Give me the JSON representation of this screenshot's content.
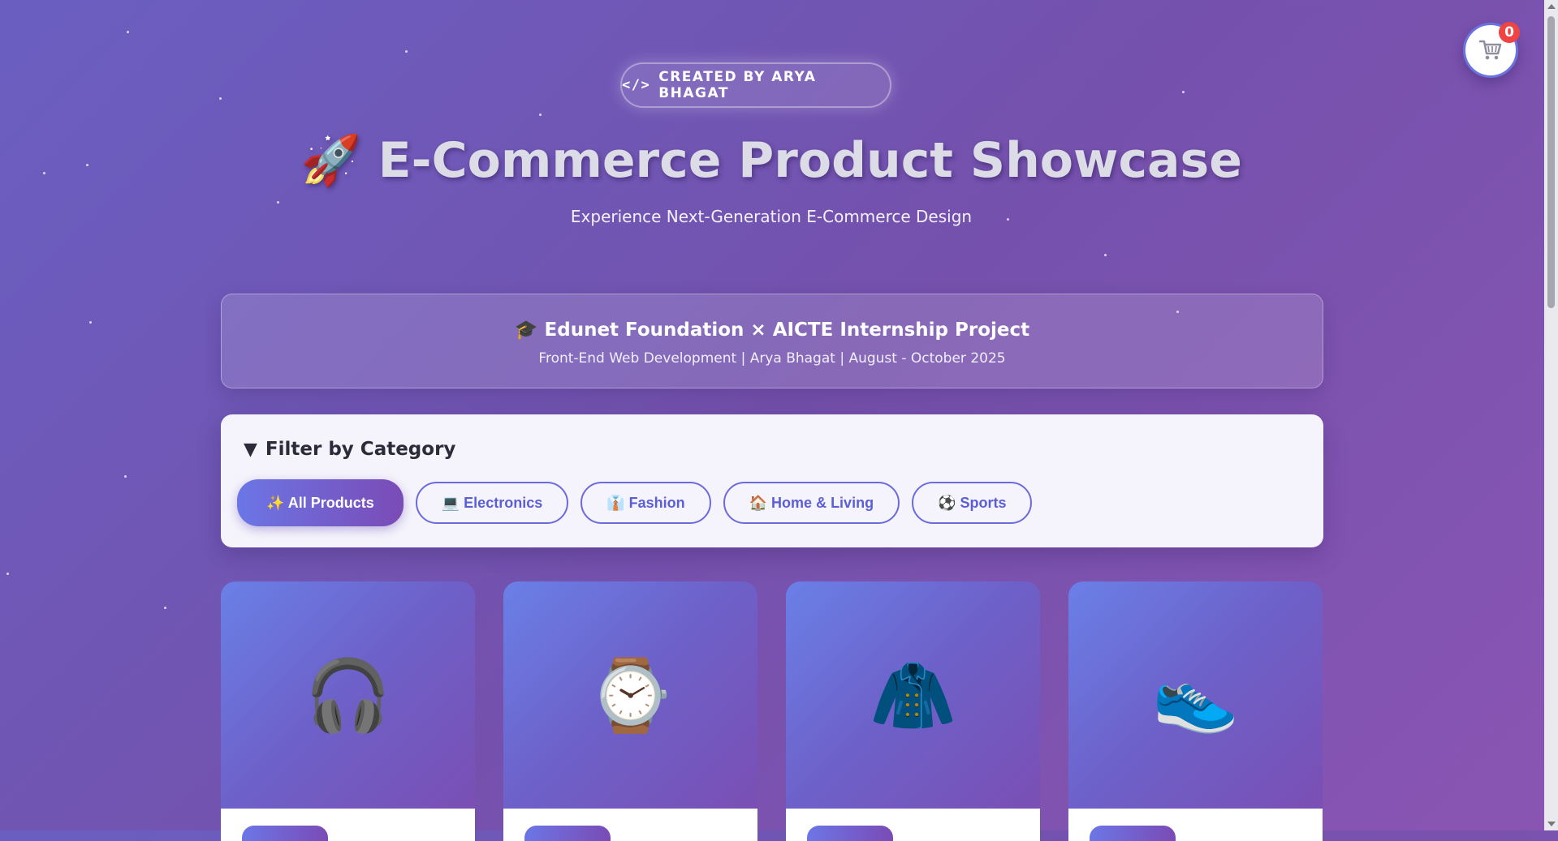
{
  "header": {
    "credit_label": "CREATED BY ARYA BHAGAT",
    "code_icon": "</>",
    "title": "🚀 E-Commerce Product Showcase",
    "subtitle": "Experience Next-Generation E-Commerce Design"
  },
  "internship": {
    "title": "🎓 Edunet Foundation × AICTE Internship Project",
    "meta": "Front-End Web Development | Arya Bhagat | August - October 2025"
  },
  "filter": {
    "heading": "Filter by Category",
    "icon": "funnel-icon",
    "categories": [
      {
        "label": "✨ All Products",
        "active": true
      },
      {
        "label": "💻 Electronics",
        "active": false
      },
      {
        "label": "👔 Fashion",
        "active": false
      },
      {
        "label": "🏠 Home & Living",
        "active": false
      },
      {
        "label": "⚽ Sports",
        "active": false
      }
    ]
  },
  "products": [
    {
      "icon": "🎧",
      "icon_name": "headphones-icon"
    },
    {
      "icon": "⌚",
      "icon_name": "watch-icon"
    },
    {
      "icon": "🧥",
      "icon_name": "coat-icon"
    },
    {
      "icon": "👟",
      "icon_name": "sneaker-icon"
    }
  ],
  "cart": {
    "count": "0",
    "icon": "cart-icon"
  },
  "colors": {
    "accent": "#6c6bdc",
    "badge_red": "#ef4444",
    "background_start": "#6a5fc1",
    "background_end": "#8a55b3"
  }
}
